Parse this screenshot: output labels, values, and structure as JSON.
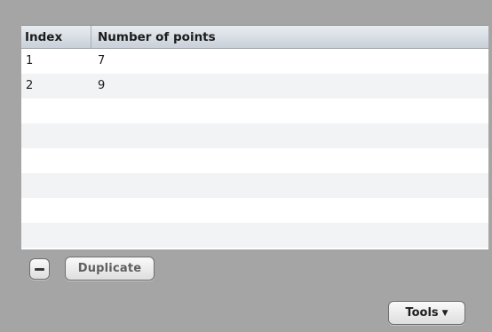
{
  "table": {
    "columns": [
      "Index",
      "Number of points"
    ],
    "rows": [
      {
        "index": "1",
        "points": "7"
      },
      {
        "index": "2",
        "points": "9"
      },
      {
        "index": "",
        "points": ""
      },
      {
        "index": "",
        "points": ""
      },
      {
        "index": "",
        "points": ""
      },
      {
        "index": "",
        "points": ""
      },
      {
        "index": "",
        "points": ""
      },
      {
        "index": "",
        "points": ""
      }
    ]
  },
  "toolbar": {
    "remove_icon": "minus-icon",
    "duplicate_label": "Duplicate",
    "tools_label": "Tools",
    "tools_chevron_icon": "chevron-down-icon"
  },
  "colors": {
    "window_background": "#a5a5a5",
    "table_header": "#d6dce3",
    "row_stripe": "#f2f3f5"
  }
}
